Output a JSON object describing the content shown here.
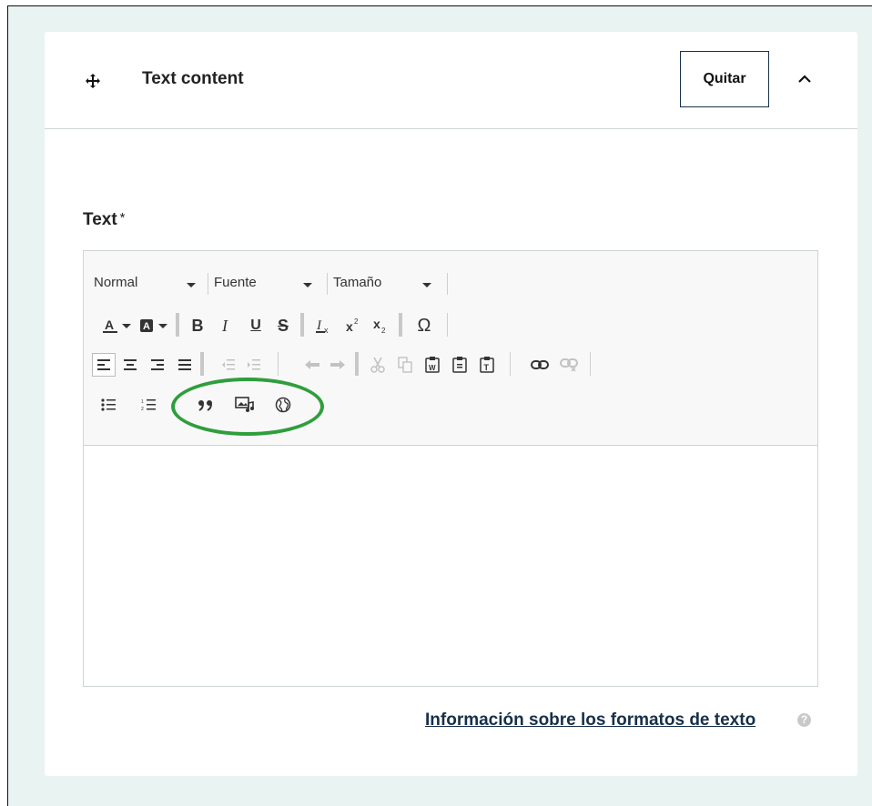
{
  "card": {
    "title": "Text content",
    "remove_label": "Quitar"
  },
  "field": {
    "label": "Text",
    "required_mark": "*"
  },
  "toolbar": {
    "format_value": "Normal",
    "font_value": "Fuente",
    "size_value": "Tamaño",
    "row2": {
      "bold": "B",
      "italic": "I",
      "underline": "U",
      "strike": "S",
      "special_char": "Ω"
    }
  },
  "footer": {
    "help_link": "Información sobre los formatos de texto",
    "help_icon": "?"
  },
  "colors": {
    "accent": "#17304a",
    "highlight": "#2f9e3c",
    "background": "#e9f3f1"
  },
  "icons": [
    "drag-handle-icon",
    "chevron-up-icon",
    "text-color-icon",
    "background-color-icon",
    "remove-format-icon",
    "superscript-icon",
    "subscript-icon",
    "align-left-icon",
    "align-center-icon",
    "align-right-icon",
    "justify-icon",
    "outdent-icon",
    "indent-icon",
    "undo-icon",
    "redo-icon",
    "cut-icon",
    "copy-icon",
    "paste-word-icon",
    "paste-icon",
    "paste-text-icon",
    "link-icon",
    "unlink-icon",
    "bulleted-list-icon",
    "numbered-list-icon",
    "blockquote-icon",
    "media-icon",
    "globe-icon",
    "help-icon"
  ]
}
